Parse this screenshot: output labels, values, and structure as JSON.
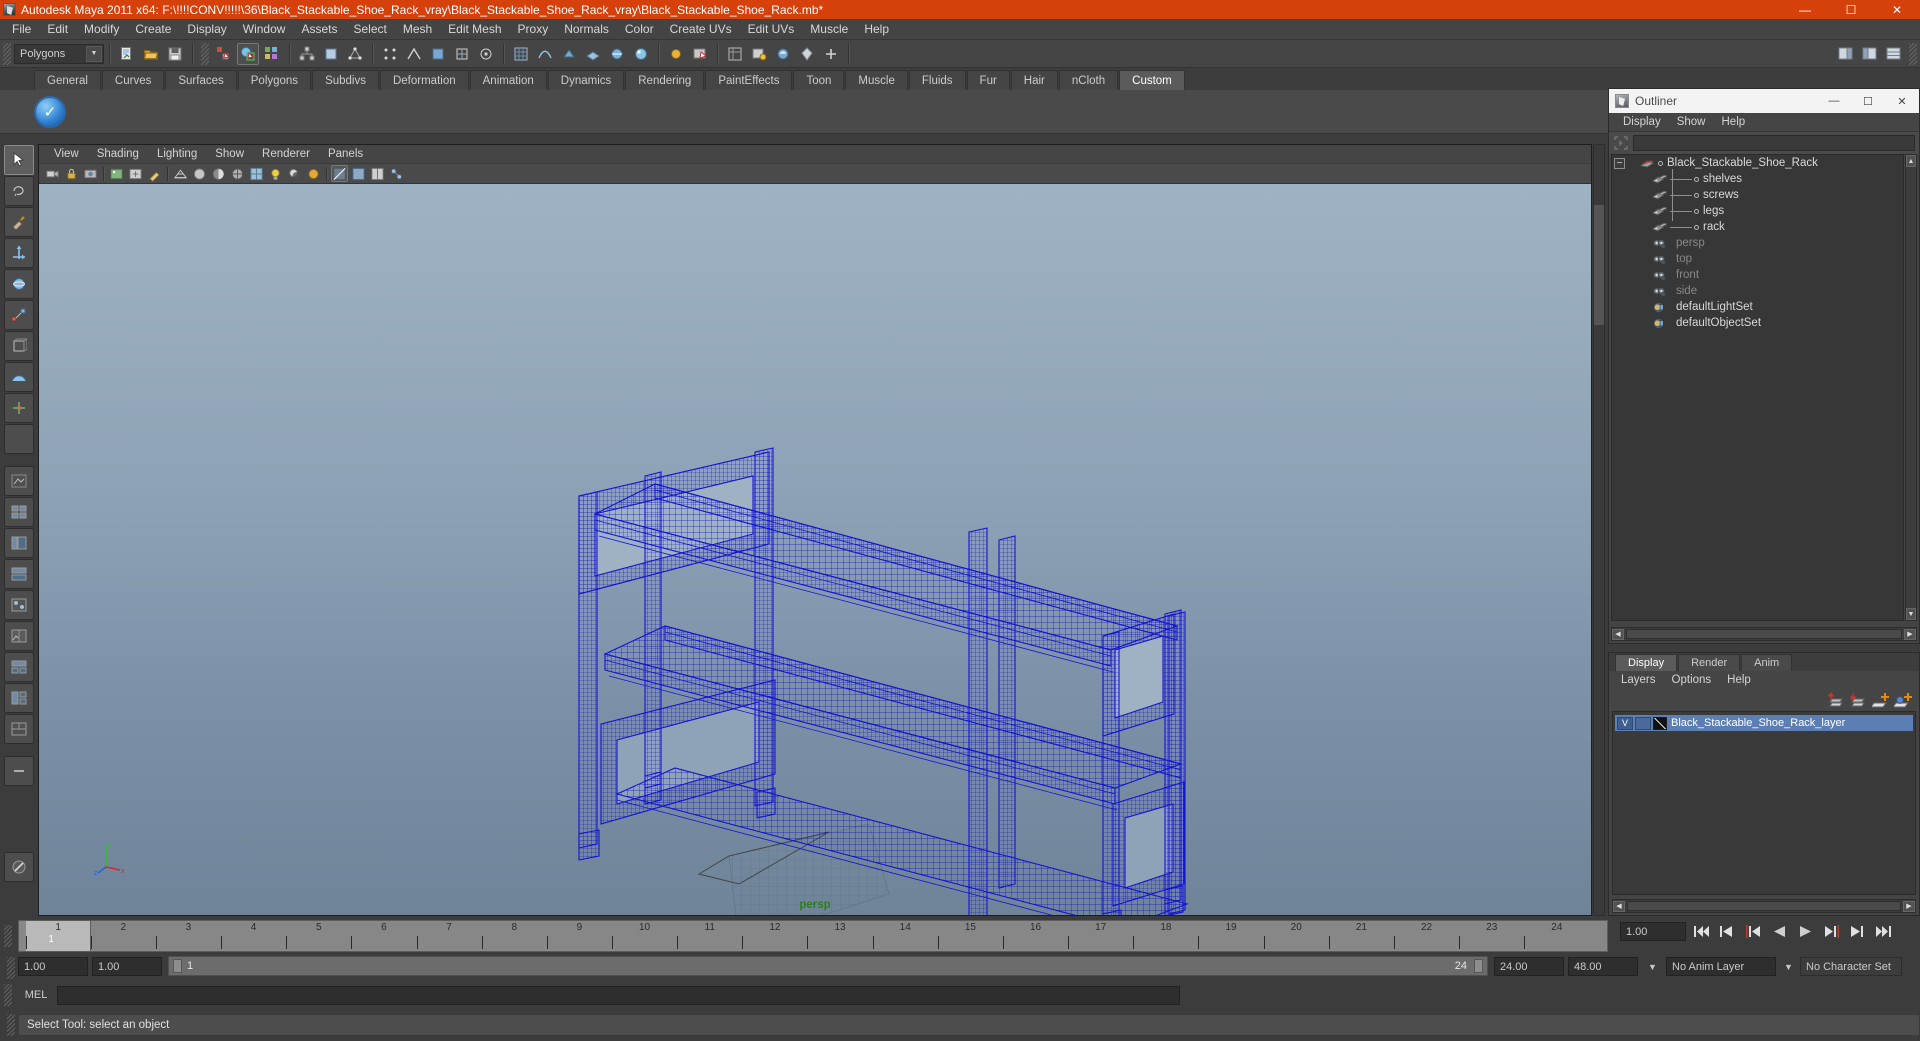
{
  "window": {
    "title": "Autodesk Maya 2011 x64: F:\\!!!!CONV!!!!!\\36\\Black_Stackable_Shoe_Rack_vray\\Black_Stackable_Shoe_Rack_vray\\Black_Stackable_Shoe_Rack.mb*",
    "minimize": "—",
    "maximize": "☐",
    "close": "✕",
    "app_icon": "maya-icon"
  },
  "menubar": {
    "items": [
      "File",
      "Edit",
      "Modify",
      "Create",
      "Display",
      "Window",
      "Assets",
      "Select",
      "Mesh",
      "Edit Mesh",
      "Proxy",
      "Normals",
      "Color",
      "Create UVs",
      "Edit UVs",
      "Muscle",
      "Help"
    ]
  },
  "statusbar": {
    "menuset": "Polygons",
    "menuset_arrow": "▼"
  },
  "shelf": {
    "tabs": [
      "General",
      "Curves",
      "Surfaces",
      "Polygons",
      "Subdivs",
      "Deformation",
      "Animation",
      "Dynamics",
      "Rendering",
      "PaintEffects",
      "Toon",
      "Muscle",
      "Fluids",
      "Fur",
      "Hair",
      "nCloth",
      "Custom"
    ],
    "active_tab": "Custom",
    "button_icon": "check-circle-icon"
  },
  "viewport": {
    "menus": [
      "View",
      "Shading",
      "Lighting",
      "Show",
      "Renderer",
      "Panels"
    ],
    "camera_label": "persp",
    "axis": {
      "x": "x",
      "y": "y",
      "z": "z"
    }
  },
  "outliner": {
    "title": "Outliner",
    "minimize": "—",
    "maximize": "☐",
    "close": "✕",
    "menus": [
      "Display",
      "Show",
      "Help"
    ],
    "search_value": "",
    "search_placeholder": "",
    "expander": "−",
    "nodes": [
      {
        "label": "Black_Stackable_Shoe_Rack",
        "icon": "transform-icon",
        "depth": 0,
        "dim": false,
        "root": true
      },
      {
        "label": "shelves",
        "icon": "mesh-icon",
        "depth": 1,
        "dim": false,
        "root": false
      },
      {
        "label": "screws",
        "icon": "mesh-icon",
        "depth": 1,
        "dim": false,
        "root": false
      },
      {
        "label": "legs",
        "icon": "mesh-icon",
        "depth": 1,
        "dim": false,
        "root": false
      },
      {
        "label": "rack",
        "icon": "mesh-icon",
        "depth": 1,
        "dim": false,
        "root": false
      },
      {
        "label": "persp",
        "icon": "camera-icon",
        "depth": 1,
        "dim": true,
        "root": false
      },
      {
        "label": "top",
        "icon": "camera-icon",
        "depth": 1,
        "dim": true,
        "root": false
      },
      {
        "label": "front",
        "icon": "camera-icon",
        "depth": 1,
        "dim": true,
        "root": false
      },
      {
        "label": "side",
        "icon": "camera-icon",
        "depth": 1,
        "dim": true,
        "root": false
      },
      {
        "label": "defaultLightSet",
        "icon": "set-icon",
        "depth": 1,
        "dim": false,
        "root": false
      },
      {
        "label": "defaultObjectSet",
        "icon": "set-icon",
        "depth": 1,
        "dim": false,
        "root": false
      }
    ]
  },
  "layer_editor": {
    "tabs": [
      "Display",
      "Render",
      "Anim"
    ],
    "active_tab": "Display",
    "menus": [
      "Layers",
      "Options",
      "Help"
    ],
    "toolbar_icons": [
      "move-layer-up-icon",
      "move-layer-down-icon",
      "new-layer-icon",
      "new-layer-from-selection-icon"
    ],
    "layers": [
      {
        "visibility": "V",
        "playback": "",
        "name": "Black_Stackable_Shoe_Rack_layer",
        "selected": true
      }
    ]
  },
  "timeline": {
    "ticks": [
      "1",
      "2",
      "3",
      "4",
      "5",
      "6",
      "7",
      "8",
      "9",
      "10",
      "11",
      "12",
      "13",
      "14",
      "15",
      "16",
      "17",
      "18",
      "19",
      "20",
      "21",
      "22",
      "23",
      "24"
    ],
    "current_frame": "1",
    "current_time_field": "1.00",
    "playback_start": "1.00",
    "anim_start": "1.00",
    "range_start": "1",
    "range_end": "24",
    "playback_end": "24.00",
    "anim_end": "48.00",
    "anim_layer": "No Anim Layer",
    "character_set": "No Character Set",
    "transport": [
      "go-to-start-icon",
      "step-back-keyframe-icon",
      "step-back-frame-icon",
      "play-backwards-icon",
      "play-forwards-icon",
      "step-forward-frame-icon",
      "step-forward-keyframe-icon",
      "go-to-end-icon"
    ]
  },
  "command_line": {
    "label": "MEL",
    "value": "",
    "help_text": "Select Tool: select an object"
  },
  "colors": {
    "title_bar": "#d6410b",
    "panel_bg": "#444444",
    "viewport_top": "#9fb2c4",
    "viewport_bottom": "#6f8499",
    "wireframe": "#1414d2",
    "camera_label": "#2e7d1e",
    "layer_selected": "#5b7fb5"
  }
}
